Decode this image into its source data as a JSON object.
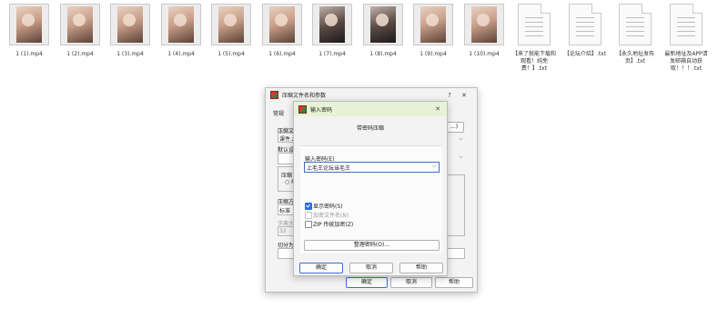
{
  "files": [
    {
      "name": "1 (1).mp4",
      "kind": "video"
    },
    {
      "name": "1 (2).mp4",
      "kind": "video"
    },
    {
      "name": "1 (3).mp4",
      "kind": "video"
    },
    {
      "name": "1 (4).mp4",
      "kind": "video"
    },
    {
      "name": "1 (5).mp4",
      "kind": "video"
    },
    {
      "name": "1 (6).mp4",
      "kind": "video"
    },
    {
      "name": "1 (7).mp4",
      "kind": "video"
    },
    {
      "name": "1 (8).mp4",
      "kind": "video"
    },
    {
      "name": "1 (9).mp4",
      "kind": "video"
    },
    {
      "name": "1 (10).mp4",
      "kind": "video"
    },
    {
      "name": "【来了就能下载和观看！纯免费！】.txt",
      "kind": "text"
    },
    {
      "name": "【论坛介绍】.txt",
      "kind": "text"
    },
    {
      "name": "【永久地址发布页】.txt",
      "kind": "text"
    },
    {
      "name": "最新地址及APP请发邮箱自动获取！！！.txt",
      "kind": "text"
    }
  ],
  "main_dialog": {
    "title": "压缩文件名和参数",
    "help_btn": "?",
    "close_btn": "✕",
    "tab": "常规",
    "label_archive": "压缩文",
    "archive_value": "课件.z",
    "label_default": "默认设",
    "label_format": "压缩",
    "label_method": "压缩方",
    "method_value": "标准",
    "label_dict": "字典大",
    "dict_value": "32",
    "label_split": "切分为",
    "browse_btn": "...)",
    "ok": "确定",
    "cancel": "取消",
    "help": "帮助"
  },
  "password_dialog": {
    "title": "输入密码",
    "close_btn": "✕",
    "heading": "带密码压缩",
    "label_password": "输入密码(E)",
    "password_value": "上毛王论坛当毛王",
    "show_password": "显示密码(S)",
    "encrypt_names": "加密文件名(N)",
    "zip_legacy": "ZIP 传统加密(Z)",
    "organize": "整理密码(O)...",
    "ok": "确定",
    "cancel": "取消",
    "help": "帮助",
    "checks": {
      "show_password": true,
      "encrypt_names": false,
      "zip_legacy": false
    }
  }
}
